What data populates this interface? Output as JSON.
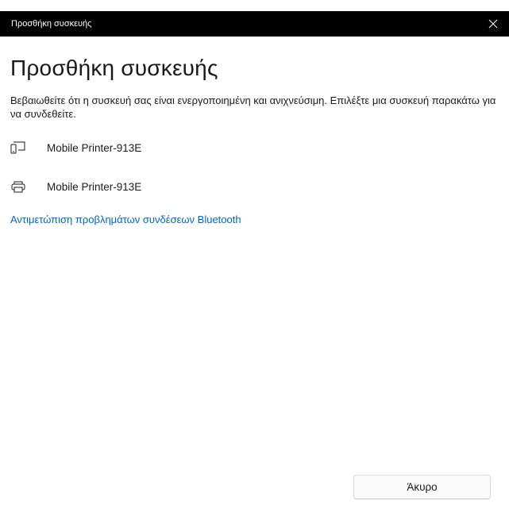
{
  "titlebar": {
    "title": "Προσθήκη συσκευής"
  },
  "main": {
    "heading": "Προσθήκη συσκευής",
    "description": "Βεβαιωθείτε ότι η συσκευή σας είναι ενεργοποιημένη και ανιχνεύσιμη. Επιλέξτε μια συσκευή παρακάτω για να συνδεθείτε.",
    "devices": [
      {
        "icon": "phone-device-icon",
        "label": "Mobile Printer-913E"
      },
      {
        "icon": "printer-icon",
        "label": "Mobile Printer-913E"
      }
    ],
    "troubleshoot_link": "Αντιμετώπιση προβλημάτων συνδέσεων Bluetooth"
  },
  "footer": {
    "cancel_label": "Άκυρο"
  },
  "colors": {
    "titlebar_bg": "#000000",
    "link": "#0067c0",
    "text": "#1a1a1a"
  }
}
